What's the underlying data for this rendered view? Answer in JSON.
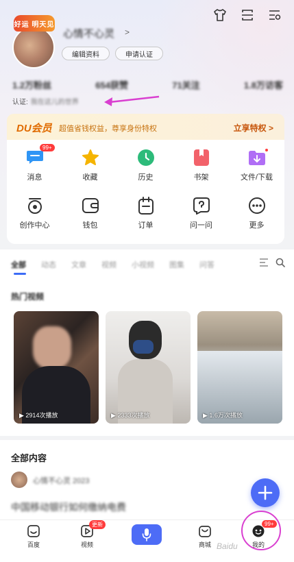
{
  "profile": {
    "avatar_badge": "好运 明天见",
    "username": "心情不心灵",
    "edit_label": "编辑资料",
    "apply_label": "申请认证",
    "cert_label": "认证:",
    "cert_value": "我在这儿的世界"
  },
  "stats": [
    "1.2万粉丝",
    "654获赞",
    "71关注",
    "1.8万访客"
  ],
  "vip": {
    "logo": "DU会员",
    "text": "超值省钱权益，尊享身份特权",
    "action": "立享特权 >"
  },
  "grid": [
    {
      "label": "消息",
      "icon": "message-icon",
      "color": "#2f95f5",
      "badge": "99+"
    },
    {
      "label": "收藏",
      "icon": "star-icon",
      "color": "#f5b400"
    },
    {
      "label": "历史",
      "icon": "clock-icon",
      "color": "#2dbb7a"
    },
    {
      "label": "书架",
      "icon": "bookmark-icon",
      "color": "#f2626a"
    },
    {
      "label": "文件/下载",
      "icon": "download-folder-icon",
      "color": "#b06ef5",
      "dot": true
    },
    {
      "label": "创作中心",
      "icon": "creator-icon"
    },
    {
      "label": "钱包",
      "icon": "wallet-icon"
    },
    {
      "label": "订单",
      "icon": "order-icon"
    },
    {
      "label": "问一问",
      "icon": "question-icon"
    },
    {
      "label": "更多",
      "icon": "more-icon"
    }
  ],
  "feed": {
    "tabs": [
      "全部",
      "动态",
      "文章",
      "视频",
      "小视频",
      "图集",
      "问答"
    ],
    "section_title": "热门视频",
    "videos": [
      {
        "plays": "▶ 2914次播放"
      },
      {
        "plays": "▶ 2333次播放"
      },
      {
        "plays": "▶ 1.6万次播放"
      }
    ]
  },
  "all_content": {
    "title": "全部内容",
    "post_user": "心情不心灵 2023",
    "post_text": "中国移动银行如何缴纳电费"
  },
  "bottom_nav": {
    "home": "百度",
    "video": "视频",
    "video_badge": "更新",
    "mall": "商城",
    "mine": "我的",
    "mine_badge": "99+"
  },
  "watermark": "Baidu",
  "colors": {
    "accent": "#4d6cf6",
    "badge": "#ff3b3b",
    "annotation": "#d93fd0"
  }
}
